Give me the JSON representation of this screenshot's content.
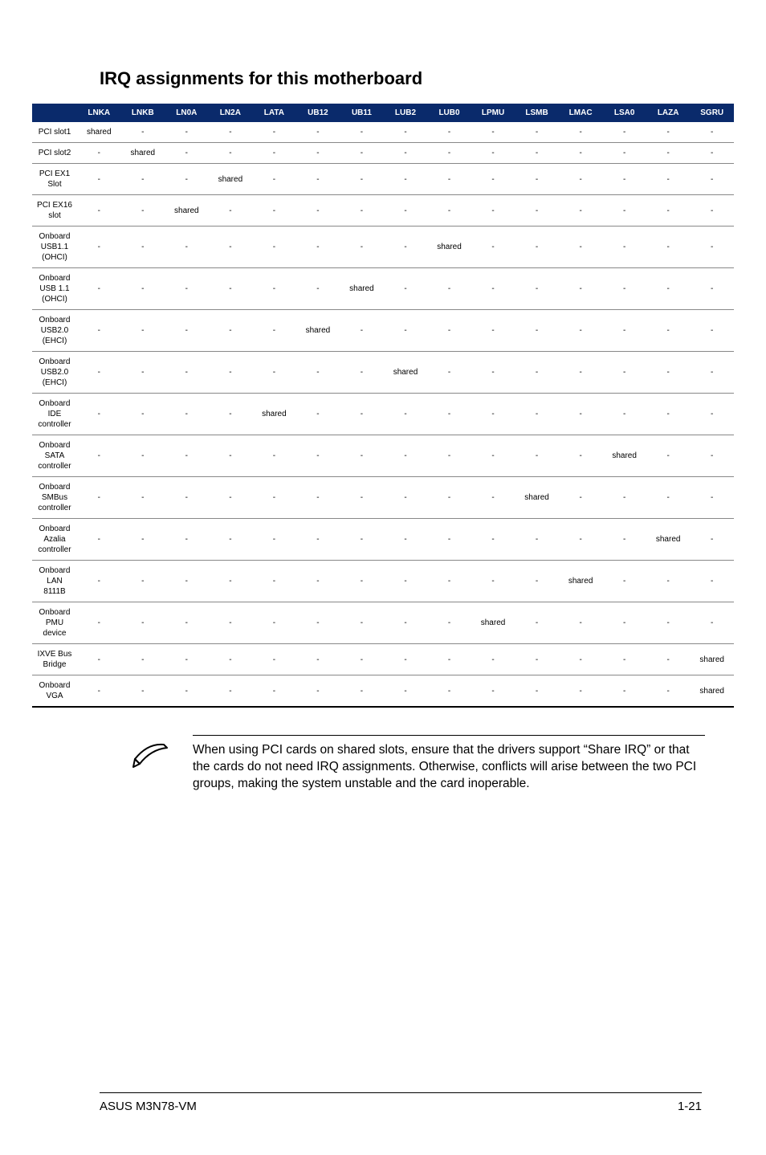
{
  "title": "IRQ assignments for this motherboard",
  "table": {
    "columns": [
      "LNKA",
      "LNKB",
      "LN0A",
      "LN2A",
      "LATA",
      "UB12",
      "UB11",
      "LUB2",
      "LUB0",
      "LPMU",
      "LSMB",
      "LMAC",
      "LSA0",
      "LAZA",
      "SGRU"
    ],
    "rows": [
      {
        "label": "PCI slot1",
        "cells": [
          "shared",
          "-",
          "-",
          "-",
          "-",
          "-",
          "-",
          "-",
          "-",
          "-",
          "-",
          "-",
          "-",
          "-",
          "-"
        ]
      },
      {
        "label": "PCI slot2",
        "cells": [
          "-",
          "shared",
          "-",
          "-",
          "-",
          "-",
          "-",
          "-",
          "-",
          "-",
          "-",
          "-",
          "-",
          "-",
          "-"
        ]
      },
      {
        "label": "PCI EX1\nSlot",
        "cells": [
          "-",
          "-",
          "-",
          "shared",
          "-",
          "-",
          "-",
          "-",
          "-",
          "-",
          "-",
          "-",
          "-",
          "-",
          "-"
        ]
      },
      {
        "label": "PCI EX16\nslot",
        "cells": [
          "-",
          "-",
          "shared",
          "-",
          "-",
          "-",
          "-",
          "-",
          "-",
          "-",
          "-",
          "-",
          "-",
          "-",
          "-"
        ]
      },
      {
        "label": "Onboard\nUSB1.1\n(OHCI)",
        "cells": [
          "-",
          "-",
          "-",
          "-",
          "-",
          "-",
          "-",
          "-",
          "shared",
          "-",
          "-",
          "-",
          "-",
          "-",
          "-"
        ]
      },
      {
        "label": "Onboard\nUSB 1.1\n(OHCI)",
        "cells": [
          "-",
          "-",
          "-",
          "-",
          "-",
          "-",
          "shared",
          "-",
          "-",
          "-",
          "-",
          "-",
          "-",
          "-",
          "-"
        ]
      },
      {
        "label": "Onboard\nUSB2.0\n(EHCI)",
        "cells": [
          "-",
          "-",
          "-",
          "-",
          "-",
          "shared",
          "-",
          "-",
          "-",
          "-",
          "-",
          "-",
          "-",
          "-",
          "-"
        ]
      },
      {
        "label": "Onboard\nUSB2.0\n(EHCI)",
        "cells": [
          "-",
          "-",
          "-",
          "-",
          "-",
          "-",
          "-",
          "shared",
          "-",
          "-",
          "-",
          "-",
          "-",
          "-",
          "-"
        ]
      },
      {
        "label": "Onboard\nIDE\ncontroller",
        "cells": [
          "-",
          "-",
          "-",
          "-",
          "shared",
          "-",
          "-",
          "-",
          "-",
          "-",
          "-",
          "-",
          "-",
          "-",
          "-"
        ]
      },
      {
        "label": "Onboard\nSATA\ncontroller",
        "cells": [
          "-",
          "-",
          "-",
          "-",
          "-",
          "-",
          "-",
          "-",
          "-",
          "-",
          "-",
          "-",
          "shared",
          "-",
          "-"
        ]
      },
      {
        "label": "Onboard\nSMBus\ncontroller",
        "cells": [
          "-",
          "-",
          "-",
          "-",
          "-",
          "-",
          "-",
          "-",
          "-",
          "-",
          "shared",
          "-",
          "-",
          "-",
          "-"
        ]
      },
      {
        "label": "Onboard\nAzalia\ncontroller",
        "cells": [
          "-",
          "-",
          "-",
          "-",
          "-",
          "-",
          "-",
          "-",
          "-",
          "-",
          "-",
          "-",
          "-",
          "shared",
          "-"
        ]
      },
      {
        "label": "Onboard\nLAN\n8111B",
        "cells": [
          "-",
          "-",
          "-",
          "-",
          "-",
          "-",
          "-",
          "-",
          "-",
          "-",
          "-",
          "shared",
          "-",
          "-",
          "-"
        ]
      },
      {
        "label": "Onboard\nPMU\ndevice",
        "cells": [
          "-",
          "-",
          "-",
          "-",
          "-",
          "-",
          "-",
          "-",
          "-",
          "shared",
          "-",
          "-",
          "-",
          "-",
          "-"
        ]
      },
      {
        "label": "IXVE Bus\nBridge",
        "cells": [
          "-",
          "-",
          "-",
          "-",
          "-",
          "-",
          "-",
          "-",
          "-",
          "-",
          "-",
          "-",
          "-",
          "-",
          "shared"
        ]
      },
      {
        "label": "Onboard\nVGA",
        "cells": [
          "-",
          "-",
          "-",
          "-",
          "-",
          "-",
          "-",
          "-",
          "-",
          "-",
          "-",
          "-",
          "-",
          "-",
          "shared"
        ]
      }
    ]
  },
  "note": "When using PCI cards on shared slots, ensure that the drivers support “Share IRQ” or that the cards do not need IRQ assignments. Otherwise, conflicts will arise between the two PCI groups, making the system unstable and the card inoperable.",
  "footer": {
    "left": "ASUS M3N78-VM",
    "right": "1-21"
  }
}
